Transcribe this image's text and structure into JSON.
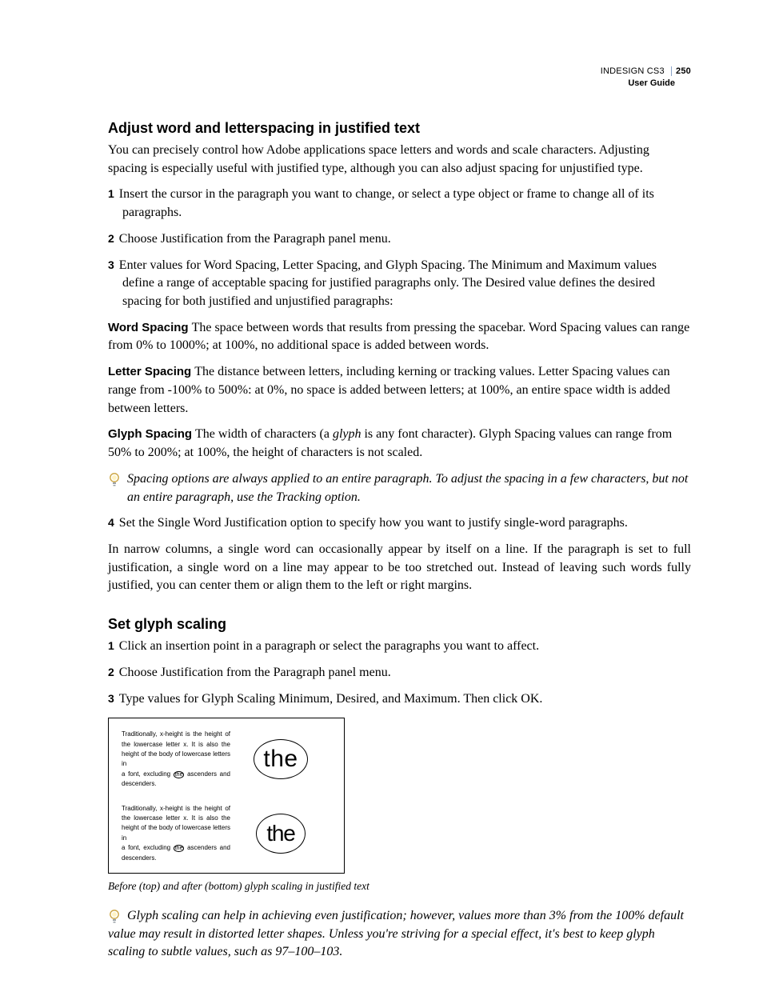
{
  "header": {
    "product": "INDESIGN CS3",
    "page_number": "250",
    "doc_title": "User Guide"
  },
  "section1": {
    "title": "Adjust word and letterspacing in justified text",
    "intro": "You can precisely control how Adobe applications space letters and words and scale characters. Adjusting spacing is especially useful with justified type, although you can also adjust spacing for unjustified type.",
    "steps": {
      "n1": "1",
      "s1": "Insert the cursor in the paragraph you want to change, or select a type object or frame to change all of its paragraphs.",
      "n2": "2",
      "s2": "Choose Justification from the Paragraph panel menu.",
      "n3": "3",
      "s3": "Enter values for Word Spacing, Letter Spacing, and Glyph Spacing. The Minimum and Maximum values define a range of acceptable spacing for justified paragraphs only. The Desired value defines the desired spacing for both justified and unjustified paragraphs:",
      "n4": "4",
      "s4": "Set the Single Word Justification option to specify how you want to justify single-word paragraphs."
    },
    "defs": {
      "ws_label": "Word Spacing",
      "ws_body": "The space between words that results from pressing the spacebar. Word Spacing values can range from 0% to 1000%; at 100%, no additional space is added between words.",
      "ls_label": "Letter Spacing",
      "ls_body": "The distance between letters, including kerning or tracking values. Letter Spacing values can range from -100% to 500%: at 0%, no space is added between letters; at 100%, an entire space width is added between letters.",
      "gs_label": "Glyph Spacing",
      "gs_body_a": "The width of characters (a ",
      "gs_body_glyph": "glyph",
      "gs_body_b": " is any font character). Glyph Spacing values can range from 50% to 200%; at 100%, the height of characters is not scaled."
    },
    "tip": "Spacing options are always applied to an entire paragraph. To adjust the spacing in a few characters, but not an entire paragraph, use the Tracking option.",
    "tail": "In narrow columns, a single word can occasionally appear by itself on a line. If the paragraph is set to full justification, a single word on a line may appear to be too stretched out. Instead of leaving such words fully justified, you can center them or align them to the left or right margins."
  },
  "section2": {
    "title": "Set glyph scaling",
    "steps": {
      "n1": "1",
      "s1": "Click an insertion point in a paragraph or select the paragraphs you want to affect.",
      "n2": "2",
      "s2": "Choose Justification from the Paragraph panel menu.",
      "n3": "3",
      "s3": "Type values for Glyph Scaling Minimum, Desired, and Maximum. Then click OK."
    },
    "figure": {
      "sample_a": "Traditionally, x-height is the height of",
      "sample_b": "the lowercase letter x. It is also the",
      "sample_c": "height of the body of lowercase letters in",
      "sample_d_pre": "a font, excluding ",
      "sample_d_circ": "the",
      "sample_d_post": " ascenders and",
      "sample_e": "descenders.",
      "the": "the",
      "caption": "Before (top) and after (bottom) glyph scaling in justified text"
    },
    "tip": "Glyph scaling can help in achieving even justification; however, values more than 3% from the 100% default value may result in distorted letter shapes. Unless you're striving for a special effect, it's best to keep glyph scaling to subtle values, such as 97–100–103."
  }
}
